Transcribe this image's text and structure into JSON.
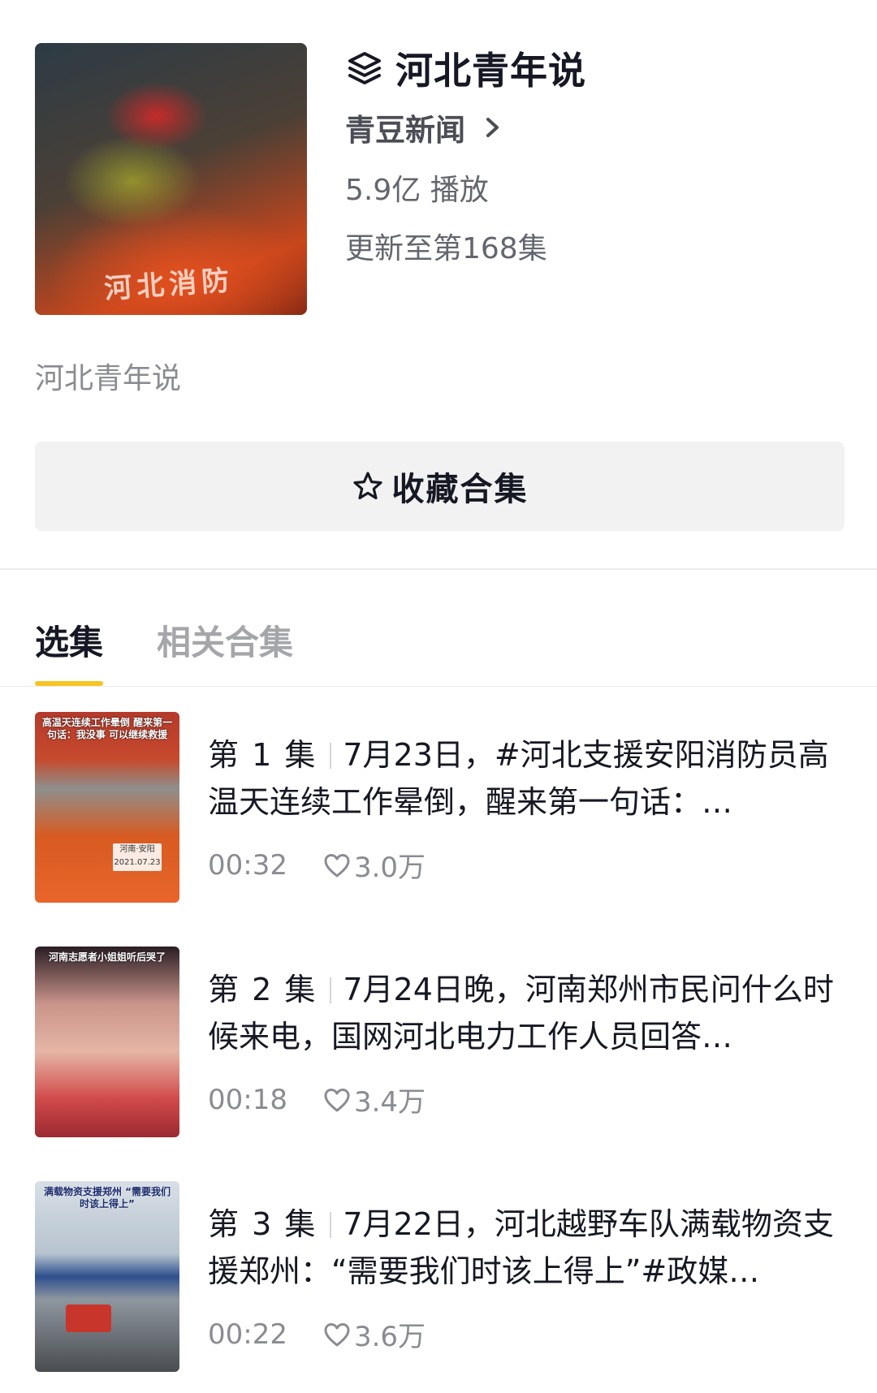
{
  "collection": {
    "title": "河北青年说",
    "source": "青豆新闻",
    "plays": "5.9亿 播放",
    "updated": "更新至第168集",
    "description": "河北青年说",
    "cover_text": "河北消防"
  },
  "favorite_button": {
    "label": "收藏合集",
    "icon": "star-outline-icon"
  },
  "tabs": [
    {
      "label": "选集",
      "active": true
    },
    {
      "label": "相关合集",
      "active": false
    }
  ],
  "episodes": [
    {
      "number": "第 1 集",
      "title": "7月23日，#河北支援安阳消防员高温天连续工作晕倒，醒来第一句话：…",
      "duration": "00:32",
      "likes": "3.0万",
      "thumb_caption": "高温天连续工作晕倒 醒来第一句话：我没事 可以继续救援",
      "thumb_tag": "河南·安阳 2021.07.23"
    },
    {
      "number": "第 2 集",
      "title": "7月24日晚，河南郑州市民问什么时候来电，国网河北电力工作人员回答…",
      "duration": "00:18",
      "likes": "3.4万",
      "thumb_caption": "河南志愿者小姐姐听后哭了"
    },
    {
      "number": "第 3 集",
      "title": "7月22日，河北越野车队满载物资支援郑州：“需要我们时该上得上”#政媒…",
      "duration": "00:22",
      "likes": "3.6万",
      "thumb_caption": "满载物资支援郑州 “需要我们时该上得上”"
    }
  ],
  "colors": {
    "accent_underline": "#f7c425",
    "button_bg": "#f2f2f3",
    "text_primary": "#161823",
    "text_secondary": "#8a8c92"
  }
}
